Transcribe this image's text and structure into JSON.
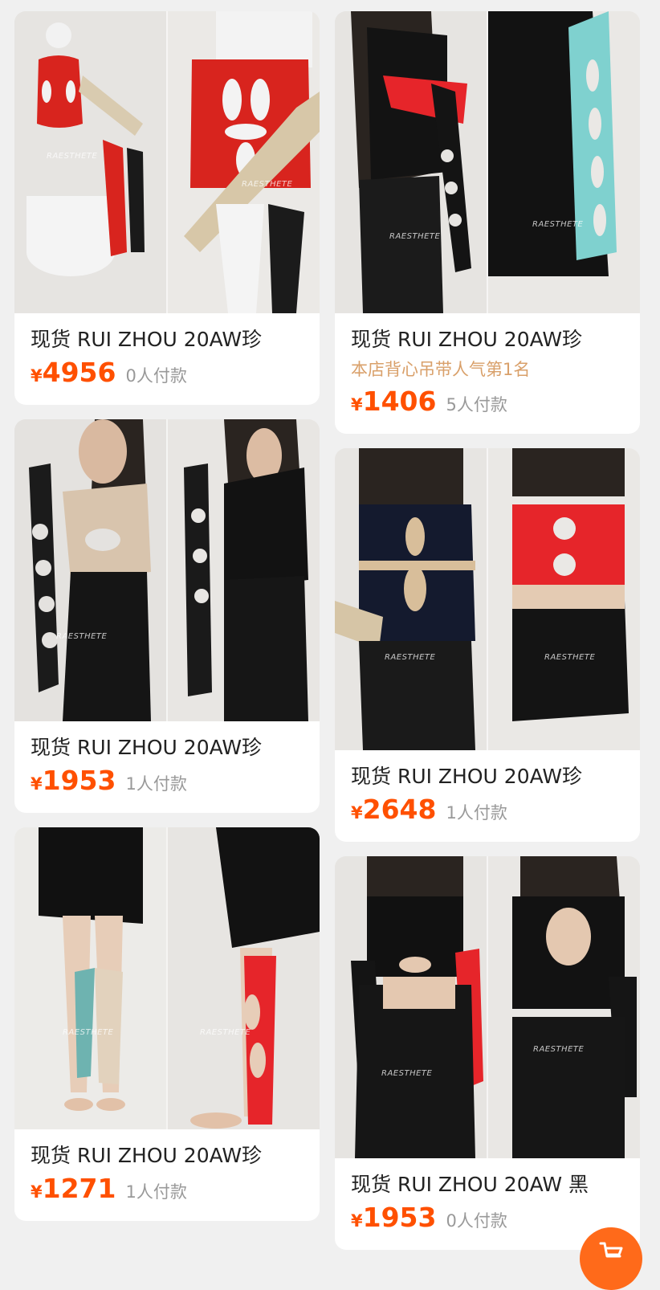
{
  "products": [
    {
      "title": "现货 RUI ZHOU 20AW珍",
      "currency": "¥",
      "price": "4956",
      "sold": "0人付款",
      "watermark": "RAESTHETE"
    },
    {
      "title": "现货 RUI ZHOU 20AW珍",
      "tagline": "本店背心吊带人气第1名",
      "currency": "¥",
      "price": "1406",
      "sold": "5人付款",
      "watermark": "RAESTHETE"
    },
    {
      "title": "现货 RUI ZHOU 20AW珍",
      "currency": "¥",
      "price": "1953",
      "sold": "1人付款",
      "watermark": "RAESTHETE"
    },
    {
      "title": "现货 RUI ZHOU 20AW珍",
      "currency": "¥",
      "price": "2648",
      "sold": "1人付款",
      "watermark": "RAESTHETE"
    },
    {
      "title": "现货 RUI ZHOU 20AW珍",
      "currency": "¥",
      "price": "1271",
      "sold": "1人付款",
      "watermark": "RAESTHETE"
    },
    {
      "title": "现货 RUI ZHOU 20AW 黑",
      "currency": "¥",
      "price": "1953",
      "sold": "0人付款",
      "watermark": "RAESTHETE"
    }
  ],
  "cart_button": {
    "icon": "cart-icon"
  },
  "colors": {
    "price": "#ff5000",
    "tagline": "#d9a06a",
    "fab": "#ff6a1a",
    "background": "#f0f0f0"
  }
}
